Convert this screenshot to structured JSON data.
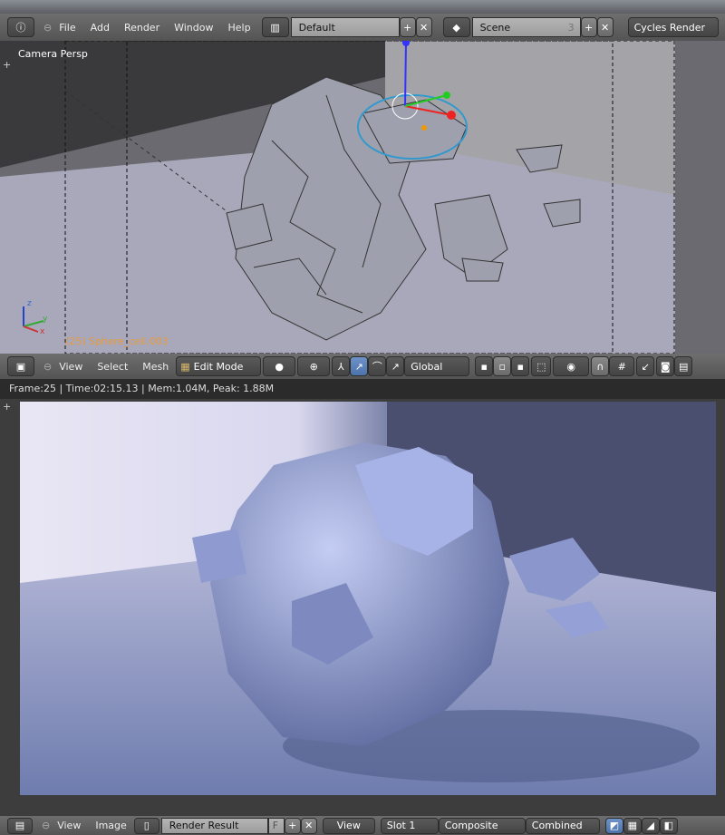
{
  "top_header": {
    "menus": [
      "File",
      "Add",
      "Render",
      "Window",
      "Help"
    ],
    "layout": "Default",
    "scene": "Scene",
    "scene_users": "3",
    "engine": "Cycles Render"
  },
  "viewport": {
    "view_label": "Camera Persp",
    "object_label": "(25) Sphere_cell.003",
    "axes": {
      "x": "x",
      "y": "y",
      "z": "z"
    }
  },
  "viewport_header": {
    "menus": [
      "View",
      "Select",
      "Mesh"
    ],
    "mode": "Edit Mode",
    "orientation": "Global"
  },
  "status": "Frame:25 | Time:02:15.13 | Mem:1.04M, Peak: 1.88M",
  "image_header": {
    "menus": [
      "View",
      "Image"
    ],
    "image_name": "Render Result",
    "fake_user": "F",
    "view": "View",
    "slot": "Slot 1",
    "layer": "Composite",
    "pass": "Combined"
  }
}
